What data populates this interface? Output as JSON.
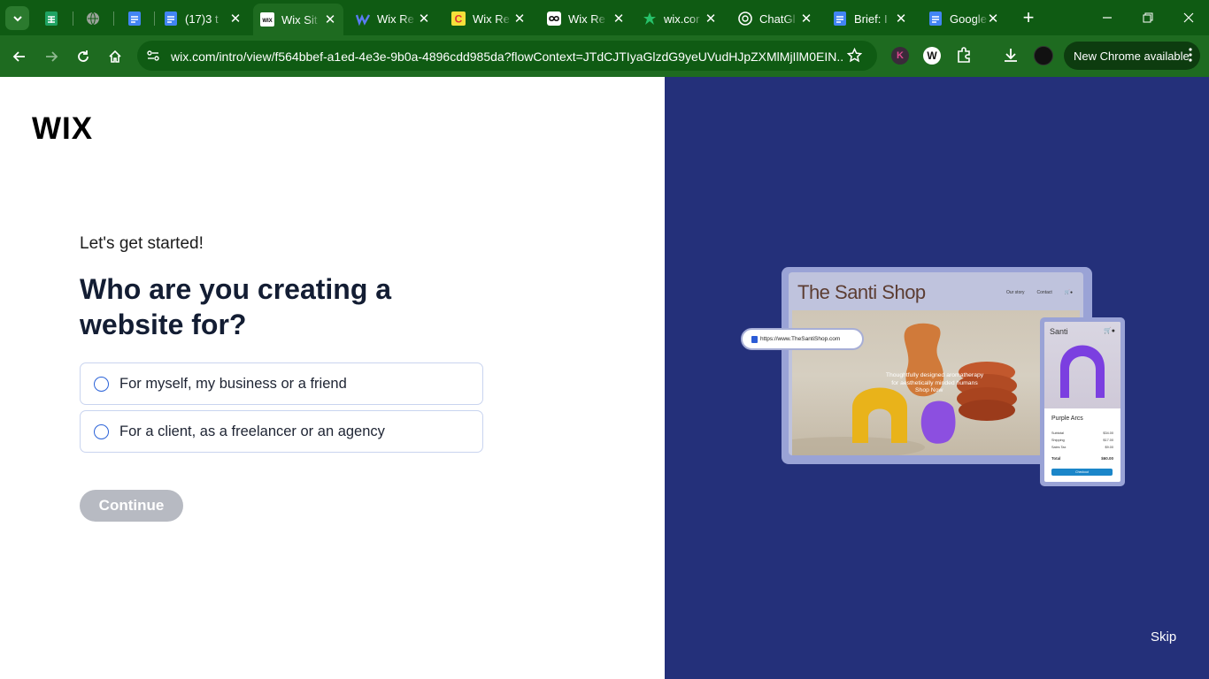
{
  "browser": {
    "tabs": [
      {
        "title": "",
        "icon": "google-sheets-icon"
      },
      {
        "title": "",
        "icon": "globe-icon"
      },
      {
        "title": "",
        "icon": "google-docs-icon"
      },
      {
        "title": "(17)3 t",
        "icon": "google-docs-icon"
      },
      {
        "title": "Wix Sit",
        "icon": "wix-icon",
        "active": true
      },
      {
        "title": "Wix Re",
        "icon": "webflow-icon"
      },
      {
        "title": "Wix Re",
        "icon": "yellow-c-icon"
      },
      {
        "title": "Wix Re",
        "icon": "infinity-icon"
      },
      {
        "title": "wix.cor",
        "icon": "green-star-icon"
      },
      {
        "title": "ChatGl",
        "icon": "chatgpt-icon"
      },
      {
        "title": "Brief: I",
        "icon": "google-docs-icon"
      },
      {
        "title": "Google",
        "icon": "google-docs-icon"
      }
    ],
    "url": "wix.com/intro/view/f564bbef-a1ed-4e3e-9b0a-4896cdd985da?flowContext=JTdCJTIyaGlzdG9yeUVudHJpZXMlMjIlM0EIN...",
    "new_chrome_label": "New Chrome available",
    "colors": {
      "frame": "#0f5b13",
      "toolbar": "#1e6b20"
    }
  },
  "page": {
    "logo": "WIX",
    "kicker": "Let's get started!",
    "heading": "Who are you creating a website for?",
    "options": [
      {
        "label": "For myself, my business or a friend",
        "selected": false
      },
      {
        "label": "For a client, as a freelancer or an agency",
        "selected": false
      }
    ],
    "continue_label": "Continue",
    "skip_label": "Skip",
    "colors": {
      "panel": "#24307a",
      "heading": "#131d33",
      "radio": "#2a62d8",
      "button_disabled": "#b7bac2"
    }
  },
  "illustration": {
    "shop_title": "The Santi Shop",
    "nav": [
      "Our story",
      "Contact"
    ],
    "url": "https://www.TheSantiShop.com",
    "caption_lines": [
      "Thoughtfully designed aromatherapy",
      "for aesthetically minded humans"
    ],
    "shop_now": "Shop Now",
    "mobile": {
      "brand": "Santi",
      "product": "Purple Arcs",
      "rows": [
        {
          "label": "Subtotal",
          "value": "$34.00"
        },
        {
          "label": "Shipping",
          "value": "$17.00"
        },
        {
          "label": "Sales Tax",
          "value": "$9.00"
        }
      ],
      "total_label": "Total",
      "total_value": "$60.00",
      "checkout_label": "Checkout"
    }
  }
}
